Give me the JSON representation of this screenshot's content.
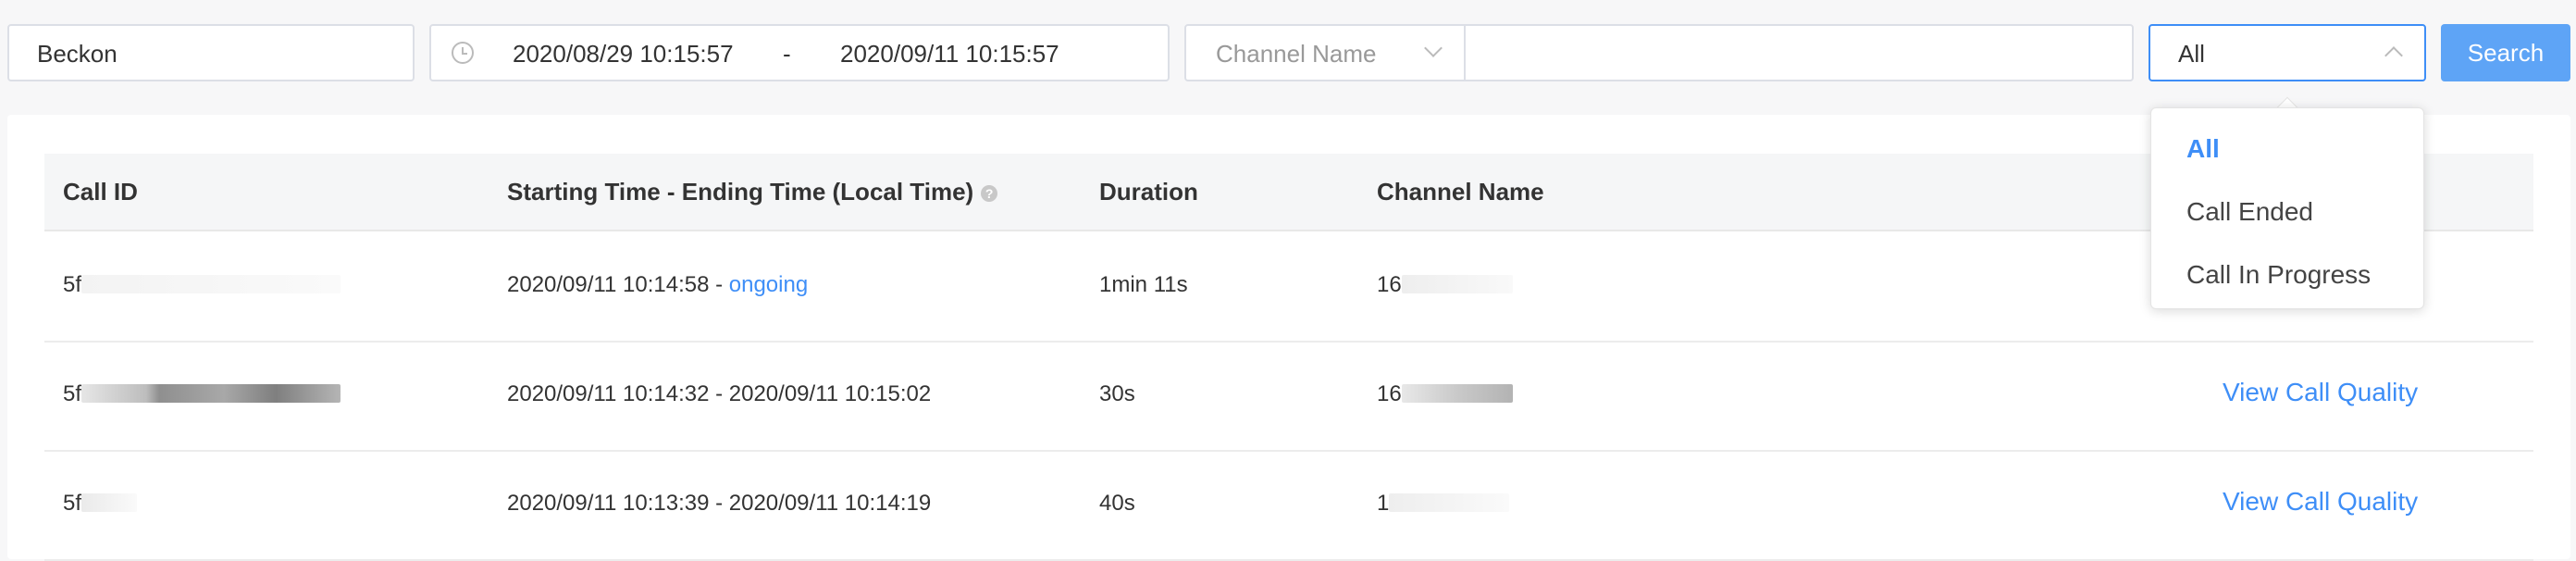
{
  "toolbar": {
    "company": "Beckon",
    "start_date": "2020/08/29 10:15:57",
    "range_separator": "-",
    "end_date": "2020/09/11 10:15:57",
    "channel_filter_label": "Channel Name",
    "channel_input_value": "",
    "status_value": "All",
    "search_label": "Search"
  },
  "status_options": [
    {
      "label": "All",
      "selected": true
    },
    {
      "label": "Call Ended",
      "selected": false
    },
    {
      "label": "Call In Progress",
      "selected": false
    }
  ],
  "table": {
    "headers": {
      "call_id": "Call ID",
      "time": "Starting Time - Ending Time (Local Time)",
      "duration": "Duration",
      "channel": "Channel Name"
    },
    "help_icon": "?",
    "rows": [
      {
        "call_id": "5f",
        "start": "2020/09/11 10:14:58 -",
        "end": "ongoing",
        "duration": "1min 11s",
        "channel": "16",
        "action": ""
      },
      {
        "call_id": "5f",
        "start": "2020/09/11 10:14:32 -",
        "end": "2020/09/11 10:15:02",
        "duration": "30s",
        "channel": "16",
        "action": "View Call Quality"
      },
      {
        "call_id": "5f",
        "start": "2020/09/11 10:13:39 -",
        "end": "2020/09/11 10:14:19",
        "duration": "40s",
        "channel": "1",
        "action": "View Call Quality"
      }
    ]
  },
  "colors": {
    "accent": "#3e8ef7",
    "button": "#5ea4f6"
  },
  "icons": {
    "clock": "clock-icon",
    "chevron": "chevron-down-icon",
    "help": "help-circle-icon"
  }
}
